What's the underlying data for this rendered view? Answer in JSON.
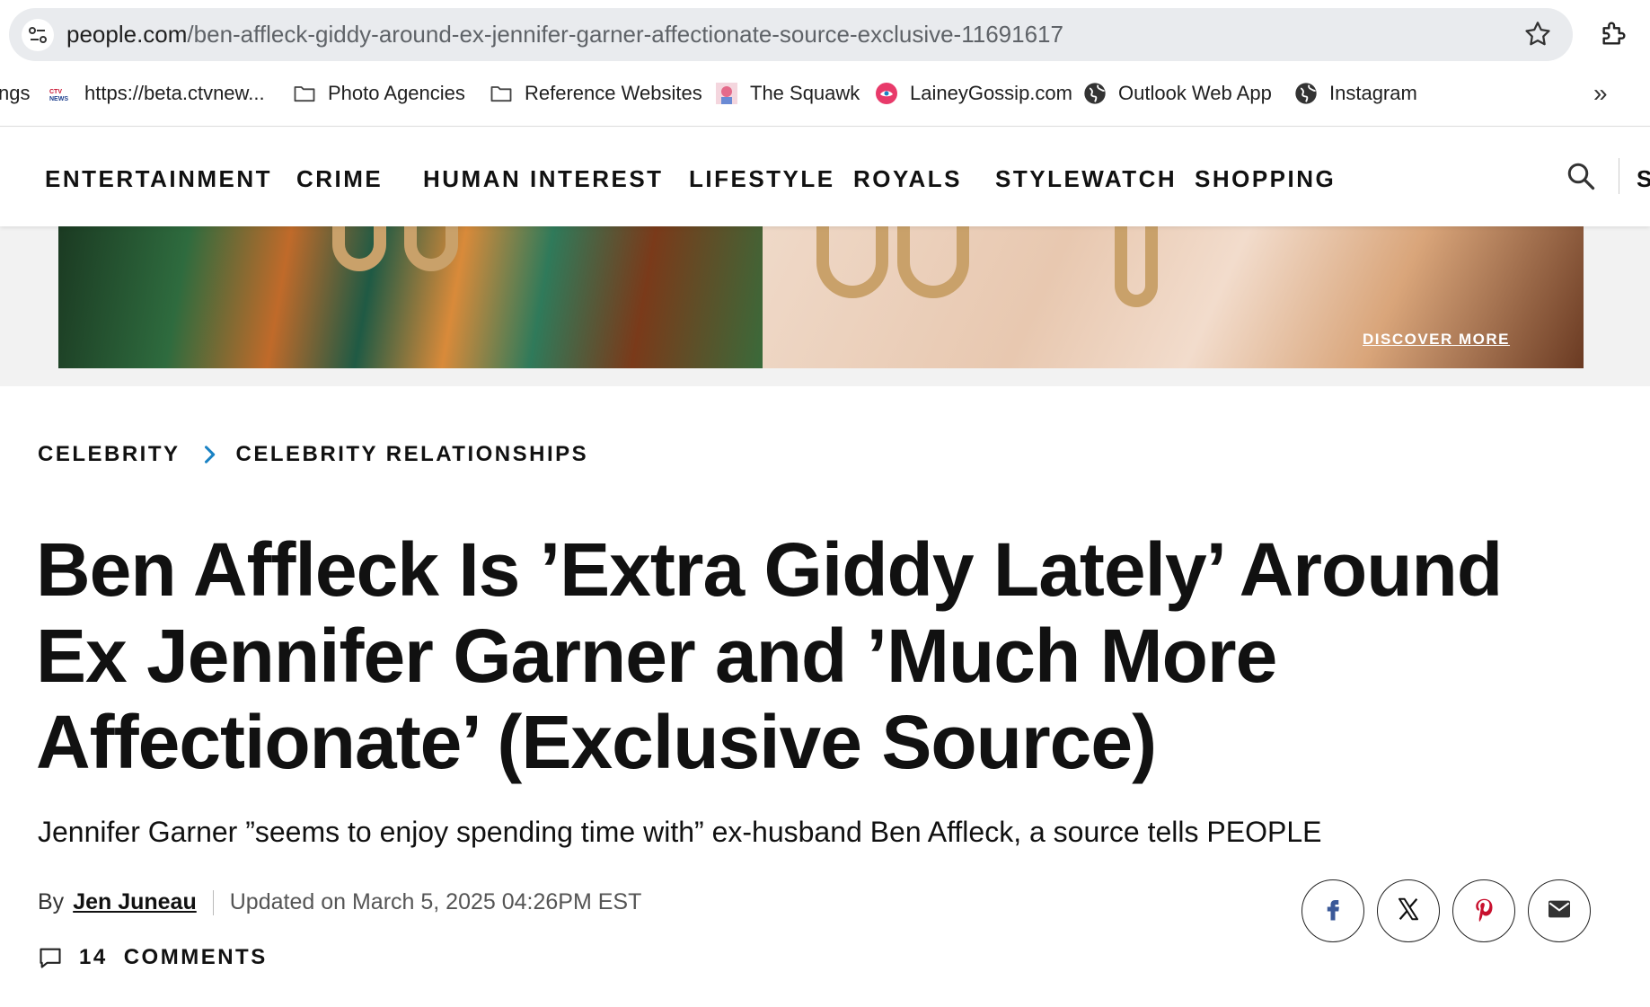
{
  "browser": {
    "url_host": "people.com",
    "url_path": "/ben-affleck-giddy-around-ex-jennifer-garner-affectionate-source-exclusive-11691617"
  },
  "bookmarks": {
    "clipped": "ngs",
    "items": [
      {
        "label": "https://beta.ctvnew...",
        "icon": "ctv-news-icon"
      },
      {
        "label": "Photo Agencies",
        "icon": "folder-icon"
      },
      {
        "label": "Reference Websites",
        "icon": "folder-icon"
      },
      {
        "label": "The Squawk",
        "icon": "squawk-icon"
      },
      {
        "label": "LaineyGossip.com",
        "icon": "lainey-icon"
      },
      {
        "label": "Outlook Web App",
        "icon": "globe-icon"
      },
      {
        "label": "Instagram",
        "icon": "globe-icon"
      }
    ],
    "more": "»"
  },
  "nav": {
    "items": [
      "ENTERTAINMENT",
      "CRIME",
      "HUMAN INTEREST",
      "LIFESTYLE",
      "ROYALS",
      "STYLEWATCH",
      "SHOPPING"
    ],
    "clipped": "S"
  },
  "ad": {
    "cta": "DISCOVER MORE"
  },
  "article": {
    "breadcrumb": [
      "CELEBRITY",
      "CELEBRITY RELATIONSHIPS"
    ],
    "headline": "Ben Affleck Is ’Extra Giddy Lately’ Around Ex Jennifer Garner and ’Much More Affectionate’ (Exclusive Source)",
    "dek": "Jennifer Garner ”seems to enjoy spending time with” ex-husband Ben Affleck, a source tells PEOPLE",
    "by_prefix": "By",
    "author": "Jen Juneau",
    "updated": "Updated on March 5, 2025 04:26PM EST",
    "comments_count": "14",
    "comments_label": "COMMENTS"
  },
  "share": [
    "facebook-icon",
    "x-icon",
    "pinterest-icon",
    "email-icon"
  ],
  "colors": {
    "accent": "#1a82c4",
    "text": "#111111",
    "facebook": "#3b5998",
    "pinterest": "#c8102e"
  }
}
